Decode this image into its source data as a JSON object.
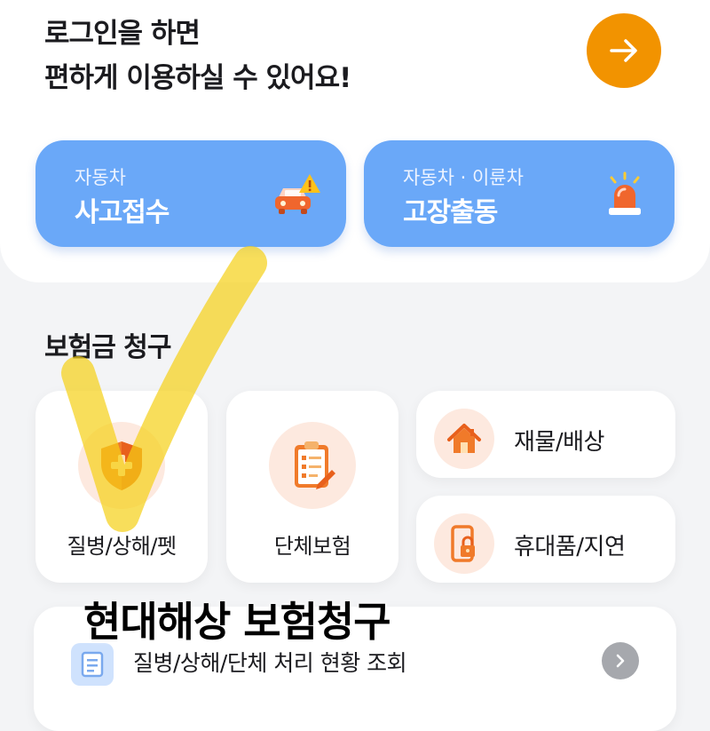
{
  "login": {
    "line1": "로그인을 하면",
    "line2": "편하게 이용하실 수 있어요!",
    "arrow_icon": "arrow-right-icon"
  },
  "quick_actions": [
    {
      "sub": "자동차",
      "label": "사고접수",
      "icon": "car-warning-icon"
    },
    {
      "sub": "자동차 · 이륜차",
      "label": "고장출동",
      "icon": "siren-icon"
    }
  ],
  "claims": {
    "title": "보험금 청구",
    "tiles": [
      {
        "label": "질병/상해/펫",
        "icon": "shield-plus-icon"
      },
      {
        "label": "단체보험",
        "icon": "clipboard-checklist-icon"
      },
      {
        "label": "재물/배상",
        "icon": "house-icon"
      },
      {
        "label": "휴대품/지연",
        "icon": "phone-lock-icon"
      }
    ]
  },
  "status": {
    "label": "질병/상해/단체 처리 현황 조회",
    "icon": "document-icon",
    "chevron_icon": "chevron-right-icon"
  },
  "overlay": {
    "caption": "현대해상 보험청구"
  },
  "colors": {
    "accent_orange": "#f29300",
    "quick_blue": "#6aa8f8",
    "icon_orange": "#f07a2a",
    "highlight_yellow": "#f5d016"
  }
}
